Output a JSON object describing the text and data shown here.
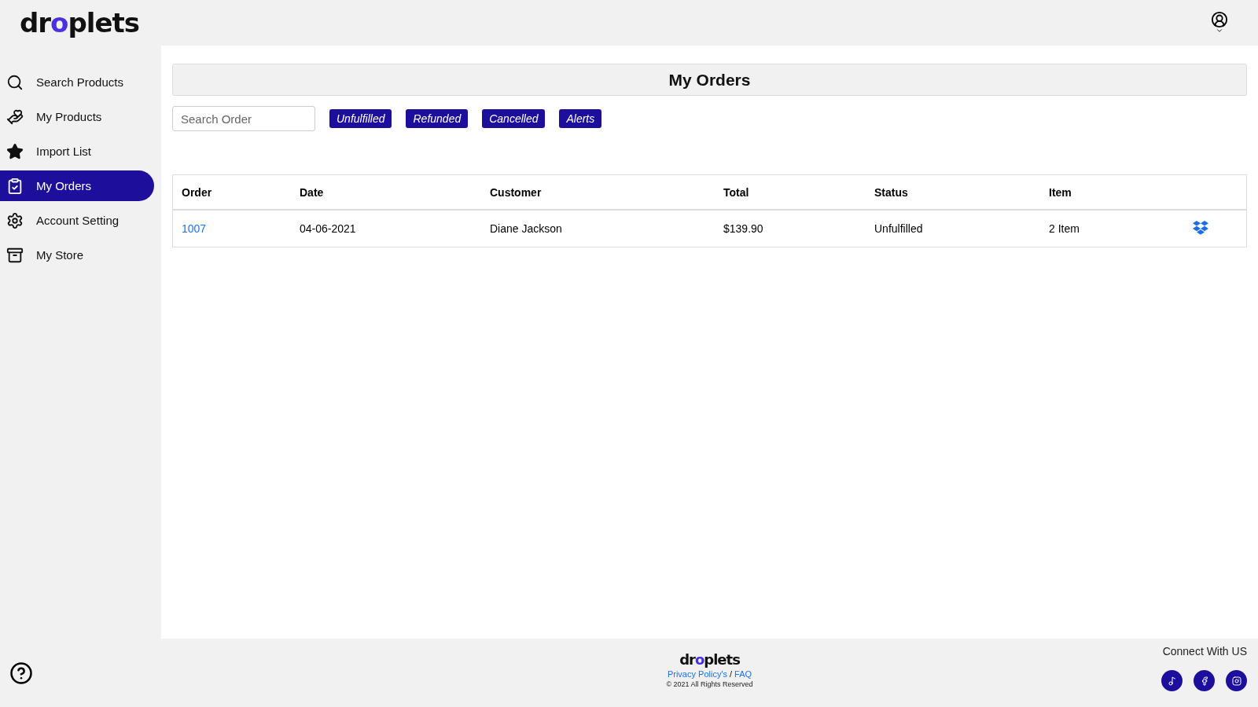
{
  "logo": "droplets",
  "sidebar": {
    "items": [
      {
        "label": "Search Products",
        "selected": false
      },
      {
        "label": "My Products",
        "selected": false
      },
      {
        "label": "Import List",
        "selected": false
      },
      {
        "label": "My Orders",
        "selected": true
      },
      {
        "label": "Account Setting",
        "selected": false
      },
      {
        "label": "My Store",
        "selected": false
      }
    ]
  },
  "page_title": "My Orders",
  "search": {
    "placeholder": "Search Order"
  },
  "filters": [
    "Unfulfilled",
    "Refunded",
    "Cancelled",
    "Alerts"
  ],
  "table": {
    "columns": [
      "Order",
      "Date",
      "Customer",
      "Total",
      "Status",
      "Item"
    ],
    "rows": [
      {
        "order": "1007",
        "date": "04-06-2021",
        "customer": "Diane Jackson",
        "total": "$139.90",
        "status": "Unfulfilled",
        "item": "2 Item"
      }
    ]
  },
  "footer": {
    "logo": "droplets",
    "privacy": "Privacy Policy's",
    "separator": "/",
    "faq": "FAQ",
    "copyright": "© 2021 All Rights Reserved",
    "connect": "Connect With US"
  }
}
